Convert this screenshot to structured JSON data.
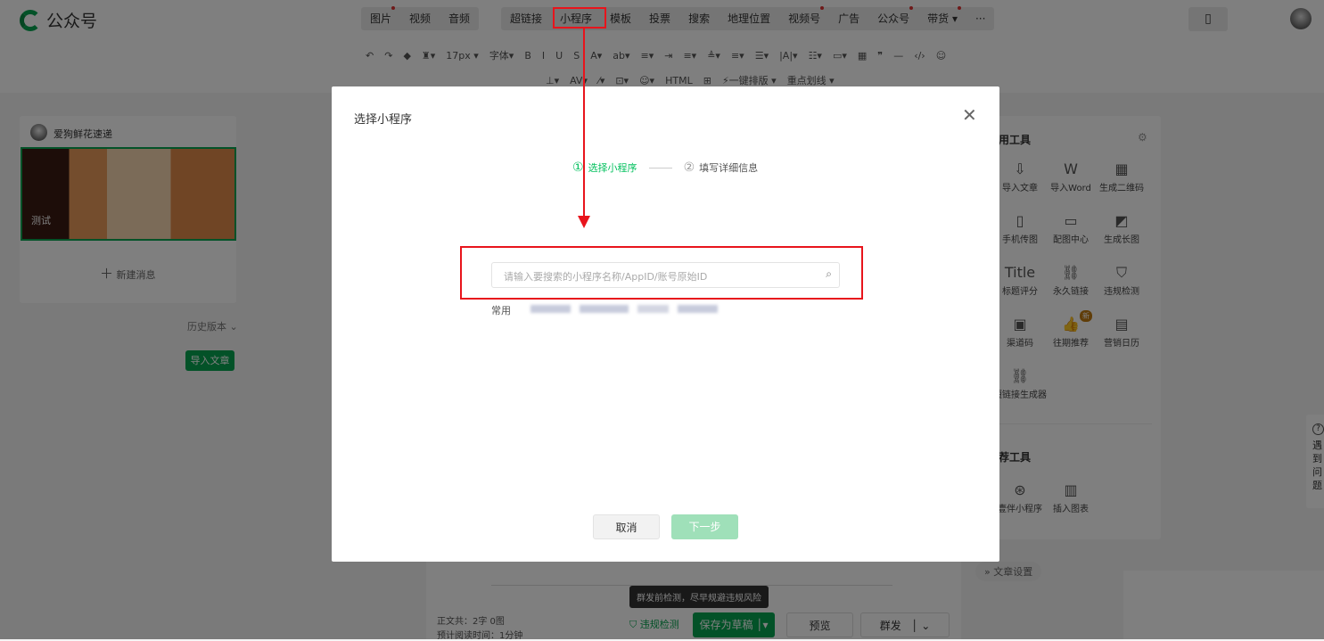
{
  "header": {
    "logo_text": "公众号",
    "menu_group1": [
      {
        "label": "图片",
        "dot": true
      },
      {
        "label": "视频",
        "dot": false
      },
      {
        "label": "音频",
        "dot": false
      }
    ],
    "menu_group2": [
      {
        "label": "超链接",
        "dot": false
      },
      {
        "label": "小程序",
        "dot": false
      },
      {
        "label": "模板",
        "dot": false
      },
      {
        "label": "投票",
        "dot": false
      },
      {
        "label": "搜索",
        "dot": false
      },
      {
        "label": "地理位置",
        "dot": false
      },
      {
        "label": "视频号",
        "dot": true
      },
      {
        "label": "广告",
        "dot": false
      },
      {
        "label": "公众号",
        "dot": true
      },
      {
        "label": "带货 ▾",
        "dot": true
      },
      {
        "label": "···",
        "dot": false
      }
    ]
  },
  "toolbar": {
    "row1": [
      "↶",
      "↷",
      "◆",
      "♜▾",
      "17px ▾",
      "字体▾",
      "B",
      "I",
      "U",
      "S",
      "A▾",
      "ab▾",
      "≡▾",
      "⇥",
      "≡▾",
      "≜▾",
      "≡▾",
      "☰▾",
      "|A|▾",
      "☷▾",
      "▭▾",
      "▦",
      "❞",
      "—",
      "‹/›",
      "☺"
    ],
    "row2": [
      "⊥▾",
      "AV▾",
      "⁄▾",
      "⊡▾",
      "☺▾",
      "HTML",
      "⊞",
      "⚡一键排版 ▾",
      "重点划线 ▾"
    ]
  },
  "left": {
    "account_name": "爱狗鲜花速递",
    "article_title": "测试",
    "new_message": "新建消息",
    "history": "历史版本",
    "import_button": "导入文章"
  },
  "right_panel": {
    "common_title": "常用工具",
    "tools": [
      {
        "icon": "⇩",
        "label": "导入文章"
      },
      {
        "icon": "W",
        "label": "导入Word"
      },
      {
        "icon": "▦",
        "label": "生成二维码"
      },
      {
        "icon": "▯",
        "label": "手机传图"
      },
      {
        "icon": "▭",
        "label": "配图中心"
      },
      {
        "icon": "◩",
        "label": "生成长图"
      },
      {
        "icon": "Title",
        "label": "标题评分"
      },
      {
        "icon": "⛓",
        "label": "永久链接"
      },
      {
        "icon": "⛉",
        "label": "违规检测"
      },
      {
        "icon": "▣",
        "label": "渠道码"
      },
      {
        "icon": "👍",
        "label": "往期推荐"
      },
      {
        "icon": "▤",
        "label": "营销日历"
      },
      {
        "icon": "⛓",
        "label": "短链接生成器"
      }
    ],
    "new_badge": "新",
    "recommend_title": "推荐工具",
    "recommend": [
      {
        "icon": "⊛",
        "label": "壹伴小程序"
      },
      {
        "icon": "▥",
        "label": "插入图表"
      }
    ],
    "article_settings": "文章设置"
  },
  "help": {
    "icon": "?",
    "text": "遇到问题"
  },
  "bottom": {
    "word_count": "正文共：2字 0图",
    "read_time": "预计阅读时间：1分钟",
    "tooltip": "群发前检测，尽早规避违规风险",
    "check": "违规检测",
    "save": "保存为草稿",
    "preview": "预览",
    "publish": "群发"
  },
  "modal": {
    "title": "选择小程序",
    "step1": "选择小程序",
    "step1_num": "①",
    "step2": "填写详细信息",
    "step2_num": "②",
    "search_placeholder": "请输入要搜索的小程序名称/AppID/账号原始ID",
    "common_label": "常用",
    "cancel": "取消",
    "next": "下一步"
  },
  "colors": {
    "accent": "#07c160",
    "annotation": "#e8141c"
  }
}
